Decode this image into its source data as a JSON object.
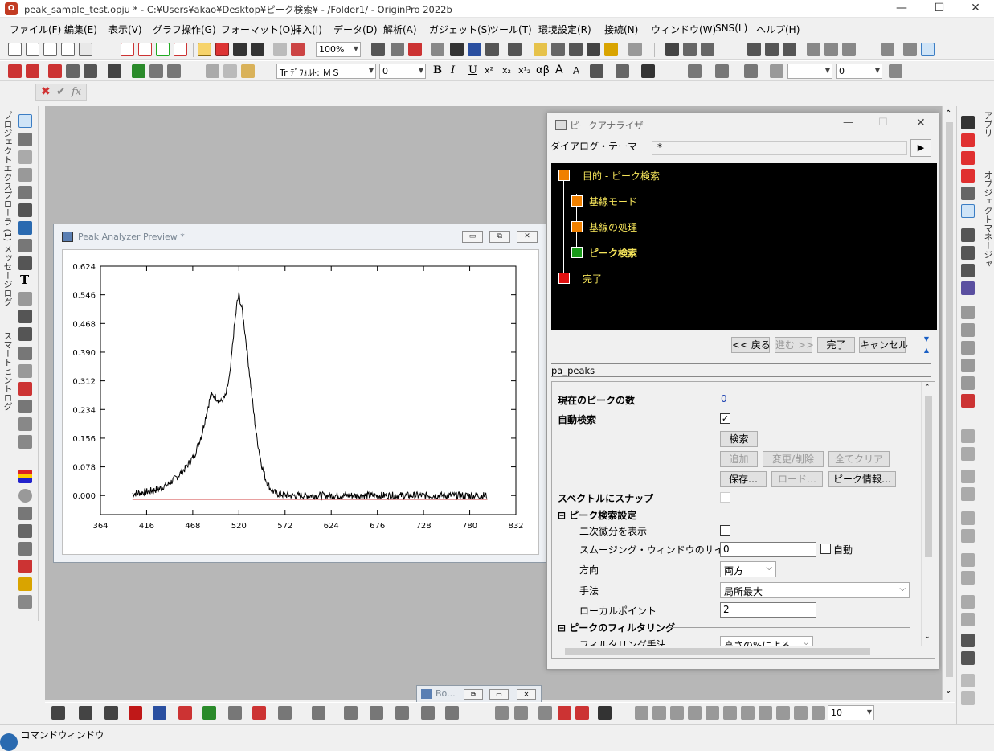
{
  "window": {
    "title": "peak_sample_test.opju * - C:¥Users¥akao¥Desktop¥ピーク検索¥ - /Folder1/ - OriginPro 2022b",
    "minimize": "—",
    "maximize": "☐",
    "close": "✕"
  },
  "menu": [
    "ファイル(F)",
    "編集(E)",
    "表示(V)",
    "グラフ操作(G)",
    "フォーマット(O)",
    "挿入(I)",
    "データ(D)",
    "解析(A)",
    "ガジェット(S)",
    "ツール(T)",
    "環境設定(R)",
    "接続(N)",
    "ウィンドウ(W)",
    "SNS(L)",
    "ヘルプ(H)"
  ],
  "toolbar": {
    "zoom": "100%",
    "font": "Tr ﾃﾞﾌｫﾙﾄ: ＭＳ",
    "font_size": "0",
    "line_width": "0",
    "bottom_size": "10"
  },
  "format_glyphs": [
    "B",
    "I",
    "U",
    "x²",
    "x₂",
    "x¹₂",
    "αβ",
    "A",
    "A"
  ],
  "formula_bar": {
    "cancel": "✖",
    "accept": "✔",
    "fx": "fx"
  },
  "left_tabs": [
    "プロジェクトエクスプローラ (1)",
    "メッセージログ",
    "スマートヒントログ"
  ],
  "right_tabs": [
    "アプリ",
    "オブジェクトマネージャ"
  ],
  "graph_window": {
    "title": "Peak Analyzer Preview *",
    "buttons": [
      "▭",
      "⧉",
      "✕"
    ]
  },
  "chart_data": {
    "type": "line",
    "xlim": [
      364,
      832
    ],
    "ylim": [
      -0.052,
      0.624
    ],
    "xticks": [
      "364",
      "416",
      "468",
      "520",
      "572",
      "624",
      "676",
      "728",
      "780",
      "832"
    ],
    "yticks": [
      "0.624",
      "0.546",
      "0.468",
      "0.390",
      "0.312",
      "0.234",
      "0.156",
      "0.078",
      "0.000"
    ],
    "series": [
      {
        "color": "#000000",
        "x": [
          400,
          410,
          420,
          430,
          440,
          450,
          460,
          470,
          478,
          484,
          488,
          492,
          496,
          500,
          505,
          510,
          514,
          518,
          520,
          524,
          528,
          532,
          536,
          540,
          545,
          550,
          555,
          560,
          565,
          570,
          580,
          600,
          650,
          700,
          750,
          790,
          800
        ],
        "y": [
          0.005,
          0.008,
          0.012,
          0.018,
          0.03,
          0.05,
          0.075,
          0.11,
          0.165,
          0.23,
          0.27,
          0.272,
          0.262,
          0.255,
          0.27,
          0.33,
          0.44,
          0.525,
          0.545,
          0.5,
          0.42,
          0.33,
          0.24,
          0.16,
          0.09,
          0.045,
          0.02,
          0.008,
          0.004,
          0.002,
          0.0,
          0.0,
          0.0,
          0.0,
          0.0,
          0.0,
          0.0
        ]
      },
      {
        "color": "#c00000",
        "x": [
          400,
          800
        ],
        "y": [
          -0.01,
          -0.01
        ]
      }
    ]
  },
  "dialog": {
    "title": "ピークアナライザ",
    "theme_label": "ダイアログ・テーマ",
    "theme_value": "*",
    "tree": [
      {
        "label": "目的 - ピーク検索",
        "color": "#f08000",
        "bold": false
      },
      {
        "label": "基線モード",
        "color": "#f08000",
        "bold": false
      },
      {
        "label": "基線の処理",
        "color": "#f08000",
        "bold": false
      },
      {
        "label": "ピーク検索",
        "color": "#1a9a1a",
        "bold": true
      },
      {
        "label": "完了",
        "color": "#e01010",
        "bold": false
      }
    ],
    "nav": {
      "back": "<< 戻る",
      "next": "進む >>",
      "finish": "完了",
      "cancel": "キャンセル"
    },
    "theme_name": "pa_peaks",
    "current_peaks_label": "現在のピークの数",
    "current_peaks_value": "0",
    "auto_find_label": "自動検索",
    "auto_find_check": "✓",
    "find_btn": "検索",
    "add_btn": "追加",
    "modify_btn": "変更/削除",
    "clear_btn": "全てクリア",
    "save_btn": "保存…",
    "load_btn": "ロード…",
    "info_btn": "ピーク情報…",
    "snap_label": "スペクトルにスナップ",
    "section1": "ピーク検索設定",
    "show_2nd_deriv": "二次微分を表示",
    "smooth_label": "スムージング・ウィンドウのサイズ",
    "smooth_value": "0",
    "auto_label": "自動",
    "direction_label": "方向",
    "direction_value": "両方",
    "method_label": "手法",
    "method_value": "局所最大",
    "local_points_label": "ローカルポイント",
    "local_points_value": "2",
    "section2": "ピークのフィルタリング",
    "filter_method_label": "フィルタリング手法",
    "filter_method_value": "高さの%による"
  },
  "minimized_window": {
    "title": "Bo..."
  },
  "command_window": {
    "label": "コマンドウィンドウ"
  }
}
